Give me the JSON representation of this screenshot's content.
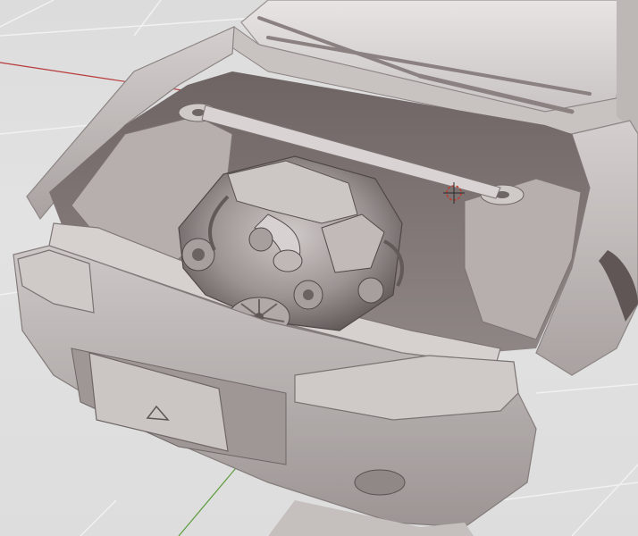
{
  "viewport": {
    "background_color": "#dedede",
    "grid_color": "#f2f2f2",
    "x_axis_color": "#b83a3a",
    "y_axis_color": "#5c9a3a",
    "gizmo_color": "#c0392b"
  },
  "scene": {
    "model_material_color": "#b9b3b3",
    "shadow_color": "#5a5150",
    "highlight_color": "#e6e2e1"
  },
  "icons": {
    "origin_gizmo": "3d-cursor-icon",
    "bumper_emblem": "triangle-emblem-icon"
  }
}
